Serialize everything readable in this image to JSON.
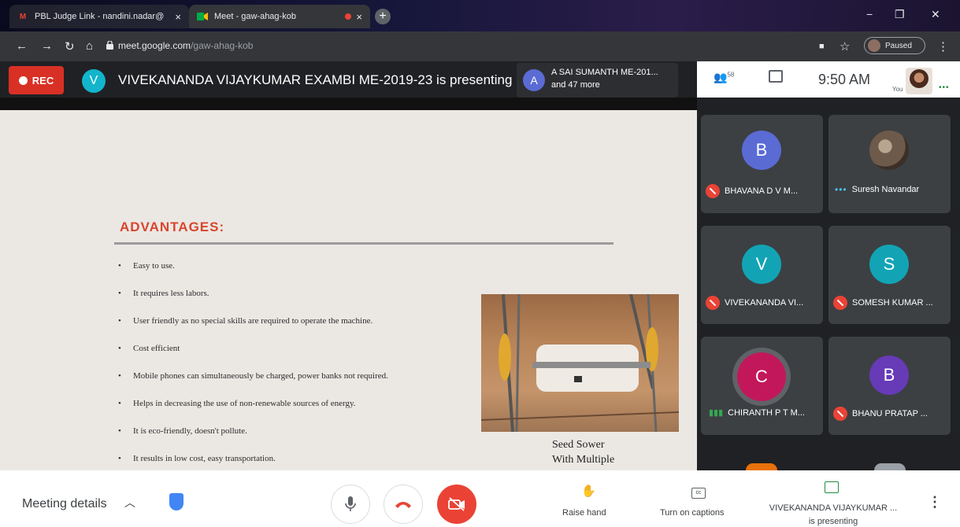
{
  "browser": {
    "tabs": [
      {
        "label": "PBL Judge Link - nandini.nadar@",
        "favicon": "gmail-icon",
        "close": "×"
      },
      {
        "label": "Meet - gaw-ahag-kob",
        "favicon": "meet-icon",
        "close": "×"
      }
    ],
    "new_tab": "+",
    "url_host": "meet.google.com",
    "url_path": "/gaw-ahag-kob",
    "profile_status": "Paused",
    "window_controls": [
      "−",
      "❐",
      "✕"
    ]
  },
  "meet_header": {
    "rec_label": "REC",
    "presenter_initial": "V",
    "presenter_text": "VIVEKANANDA VIJAYKUMAR EXAMBI ME-2019-23 is presenting",
    "participant_initial": "A",
    "participant_line1": "A SAI SUMANTH ME-201...",
    "participant_line2": "and 47 more"
  },
  "right_bar": {
    "people_count": "58",
    "time": "9:50 AM",
    "you_label": "You",
    "dots": "•••"
  },
  "slide": {
    "title": "ADVANTAGES:",
    "bullets": [
      "Easy to use.",
      "It requires less labors.",
      "User friendly as no special skills are required to operate the machine.",
      "Cost efficient",
      "Mobile phones can simultaneously be charged, power banks not required.",
      "Helps in decreasing the use of non-renewable sources of energy.",
      "It is eco-friendly, doesn't  pollute.",
      " It results in low cost, easy transportation."
    ],
    "caption_line1": "Seed Sower",
    "caption_line2": "With Multiple"
  },
  "participants": [
    {
      "initial": "B",
      "name": "BHAVANA D V M...",
      "color": "#5b6bd4",
      "status": "muted"
    },
    {
      "initial": "",
      "name": "Suresh Navandar",
      "color": "#6d5a4b",
      "status": "more"
    },
    {
      "initial": "V",
      "name": "VIVEKANANDA VI...",
      "color": "#12a4b5",
      "status": "muted"
    },
    {
      "initial": "S",
      "name": "SOMESH KUMAR ...",
      "color": "#12a4b5",
      "status": "muted"
    },
    {
      "initial": "C",
      "name": "CHIRANTH P T M...",
      "color": "#c2185b",
      "status": "talking"
    },
    {
      "initial": "B",
      "name": "BHANU PRATAP ...",
      "color": "#673ab7",
      "status": "muted"
    }
  ],
  "bottom_bar": {
    "meeting_details": "Meeting details",
    "raise_hand": "Raise hand",
    "captions": "Turn on captions",
    "presenting_line1": "VIVEKANANDA VIJAYKUMAR ...",
    "presenting_line2": "is presenting"
  }
}
